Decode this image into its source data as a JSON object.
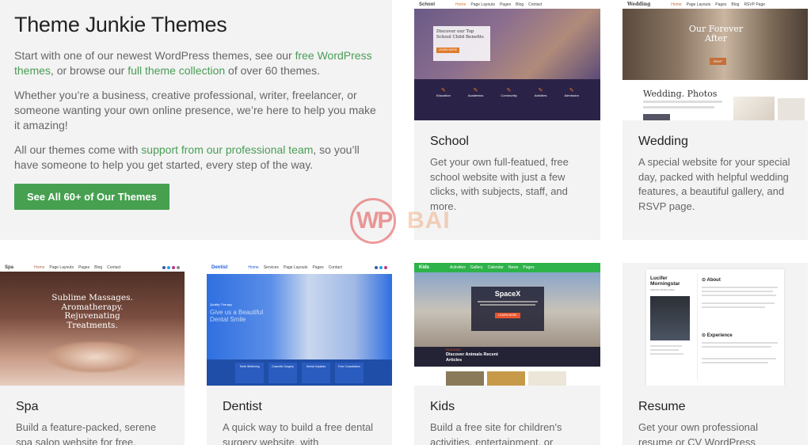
{
  "intro": {
    "title": "Theme Junkie Themes",
    "p1_a": "Start with one of our newest WordPress themes, see our ",
    "p1_link1": "free WordPress themes",
    "p1_b": ", or browse our ",
    "p1_link2": "full theme collection",
    "p1_c": " of over 60 themes.",
    "p2": "Whether you’re a business, creative professional, writer, freelancer, or someone wanting your own online presence, we’re here to help you make it amazing!",
    "p3_a": "All our themes come with ",
    "p3_link": "support from our professional team",
    "p3_b": ", so you’ll have someone to help you get started, every step of the way.",
    "cta": "See All 60+ of Our Themes"
  },
  "cards": {
    "school": {
      "title": "School",
      "desc": "Get your own full-featued, free school website with just a few clicks, with subjects, staff, and more.",
      "thumb_logo": "School",
      "thumb_nav": [
        "Home",
        "Page Layouts",
        "Pages",
        "Blog",
        "Contact"
      ],
      "thumb_hero": "Discover our Top School Child Benefits",
      "thumb_btn": "LEARN MORE",
      "thumb_features": [
        "Education",
        "Academics",
        "Community",
        "Activities",
        "Admission"
      ]
    },
    "wedding": {
      "title": "Wedding",
      "desc": "A special website for your special day, packed with helpful wedding features, a beautiful gallery, and RSVP page.",
      "thumb_logo": "Wedding",
      "thumb_nav": [
        "Home",
        "Page Layouts",
        "Pages",
        "Blog",
        "RSVP Page"
      ],
      "thumb_hero": "Our Forever After",
      "thumb_btn": "RSVP",
      "thumb_section": "Wedding. Photos"
    },
    "spa": {
      "title": "Spa",
      "desc": "Build a feature-packed, serene spa salon website for free.",
      "thumb_logo": "Spa",
      "thumb_nav": [
        "Home",
        "Page Layouts",
        "Pages",
        "Blog",
        "Contact"
      ],
      "thumb_hero": "Sublime Massages. Aromatherapy. Rejuvenating Treatments."
    },
    "dentist": {
      "title": "Dentist",
      "desc": "A quick way to build a free dental surgery website, with",
      "thumb_logo": "Dentist",
      "thumb_nav": [
        "Home",
        "Services",
        "Page Layouts",
        "Pages",
        "Contact"
      ],
      "thumb_tag": "Quality Therapy",
      "thumb_hero": "Give us a Beautiful Dental Smile",
      "thumb_features": [
        "Teeth Whitening",
        "Cosmetic Surgery",
        "Dental Implants",
        "Free Consultation"
      ]
    },
    "kids": {
      "title": "Kids",
      "desc": "Build a free site for children's activities, entertainment, or",
      "thumb_logo": "Kids",
      "thumb_nav": [
        "Activities",
        "Gallery",
        "Calendar",
        "News",
        "Pages"
      ],
      "thumb_hero": "SpaceX",
      "thumb_btn": "LEARN MORE",
      "thumb_tag": "FEATURED",
      "thumb_caption": "Discover Animals Recent Articles"
    },
    "resume": {
      "title": "Resume",
      "desc": "Get your own professional resume or CV WordPress",
      "thumb_name": "Lucifer Morningstar",
      "thumb_role": "SENIOR DEVELOPER",
      "thumb_about": "About",
      "thumb_experience": "Experience"
    }
  },
  "watermark": {
    "left": "WP",
    "right": "BAI"
  },
  "colors": {
    "accent_green": "#46a050",
    "link_green": "#4a9d55",
    "panel_bg": "#f3f3f3",
    "school_navy": "#2b2347",
    "dentist_blue": "#1f5fd6",
    "kids_green": "#2db34a",
    "kids_dark": "#242336"
  }
}
